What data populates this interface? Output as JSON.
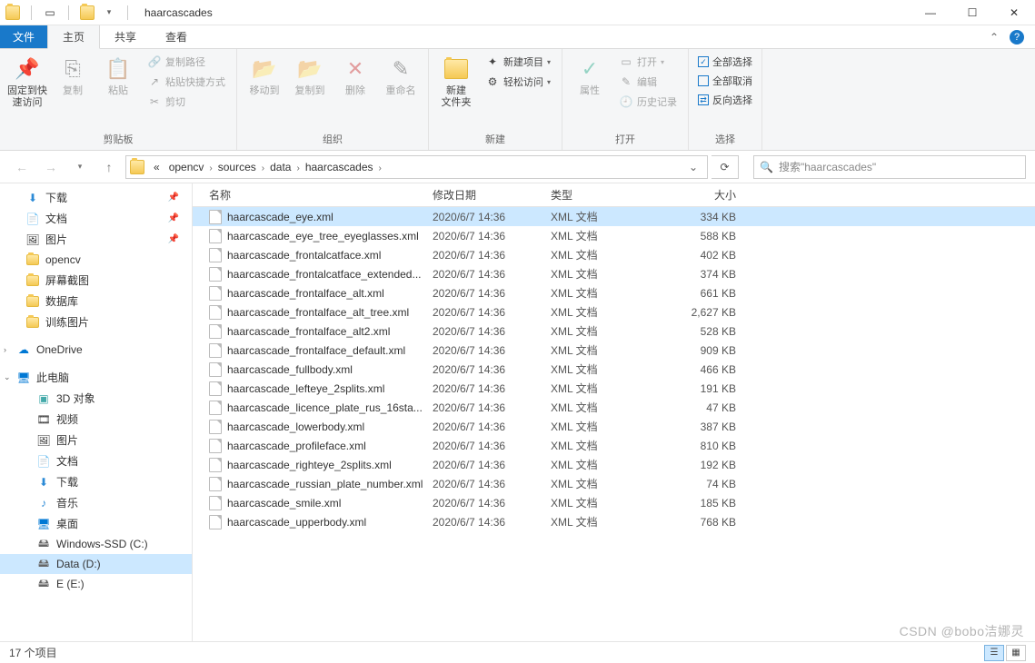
{
  "window": {
    "title": "haarcascades"
  },
  "tabs": {
    "file": "文件",
    "home": "主页",
    "share": "共享",
    "view": "查看"
  },
  "ribbon": {
    "pin": "固定到快\n速访问",
    "copy": "复制",
    "paste": "粘贴",
    "copy_path": "复制路径",
    "paste_shortcut": "粘贴快捷方式",
    "cut": "剪切",
    "clipboard_group": "剪贴板",
    "move_to": "移动到",
    "copy_to": "复制到",
    "delete": "删除",
    "rename": "重命名",
    "organize_group": "组织",
    "new_folder": "新建\n文件夹",
    "new_item": "新建项目",
    "easy_access": "轻松访问",
    "new_group": "新建",
    "properties": "属性",
    "open": "打开",
    "edit": "编辑",
    "history": "历史记录",
    "open_group": "打开",
    "select_all": "全部选择",
    "select_none": "全部取消",
    "invert": "反向选择",
    "select_group": "选择"
  },
  "breadcrumb": {
    "parts": [
      "opencv",
      "sources",
      "data",
      "haarcascades"
    ],
    "prefix": "«"
  },
  "search": {
    "placeholder": "搜索\"haarcascades\""
  },
  "nav": {
    "downloads": "下载",
    "documents": "文档",
    "pictures": "图片",
    "opencv": "opencv",
    "screenshots": "屏幕截图",
    "database": "数据库",
    "train_pics": "训练图片",
    "onedrive": "OneDrive",
    "this_pc": "此电脑",
    "objects3d": "3D 对象",
    "videos": "视频",
    "pictures2": "图片",
    "documents2": "文档",
    "downloads2": "下载",
    "music": "音乐",
    "desktop": "桌面",
    "disk_c": "Windows-SSD (C:)",
    "disk_d": "Data (D:)",
    "disk_e": "E (E:)"
  },
  "columns": {
    "name": "名称",
    "date": "修改日期",
    "type": "类型",
    "size": "大小"
  },
  "file_type": "XML 文档",
  "files": [
    {
      "name": "haarcascade_eye.xml",
      "date": "2020/6/7 14:36",
      "size": "334 KB",
      "selected": true
    },
    {
      "name": "haarcascade_eye_tree_eyeglasses.xml",
      "date": "2020/6/7 14:36",
      "size": "588 KB"
    },
    {
      "name": "haarcascade_frontalcatface.xml",
      "date": "2020/6/7 14:36",
      "size": "402 KB"
    },
    {
      "name": "haarcascade_frontalcatface_extended...",
      "date": "2020/6/7 14:36",
      "size": "374 KB"
    },
    {
      "name": "haarcascade_frontalface_alt.xml",
      "date": "2020/6/7 14:36",
      "size": "661 KB"
    },
    {
      "name": "haarcascade_frontalface_alt_tree.xml",
      "date": "2020/6/7 14:36",
      "size": "2,627 KB"
    },
    {
      "name": "haarcascade_frontalface_alt2.xml",
      "date": "2020/6/7 14:36",
      "size": "528 KB"
    },
    {
      "name": "haarcascade_frontalface_default.xml",
      "date": "2020/6/7 14:36",
      "size": "909 KB"
    },
    {
      "name": "haarcascade_fullbody.xml",
      "date": "2020/6/7 14:36",
      "size": "466 KB"
    },
    {
      "name": "haarcascade_lefteye_2splits.xml",
      "date": "2020/6/7 14:36",
      "size": "191 KB"
    },
    {
      "name": "haarcascade_licence_plate_rus_16sta...",
      "date": "2020/6/7 14:36",
      "size": "47 KB"
    },
    {
      "name": "haarcascade_lowerbody.xml",
      "date": "2020/6/7 14:36",
      "size": "387 KB"
    },
    {
      "name": "haarcascade_profileface.xml",
      "date": "2020/6/7 14:36",
      "size": "810 KB"
    },
    {
      "name": "haarcascade_righteye_2splits.xml",
      "date": "2020/6/7 14:36",
      "size": "192 KB"
    },
    {
      "name": "haarcascade_russian_plate_number.xml",
      "date": "2020/6/7 14:36",
      "size": "74 KB"
    },
    {
      "name": "haarcascade_smile.xml",
      "date": "2020/6/7 14:36",
      "size": "185 KB"
    },
    {
      "name": "haarcascade_upperbody.xml",
      "date": "2020/6/7 14:36",
      "size": "768 KB"
    }
  ],
  "status": {
    "count": "17 个项目"
  },
  "watermark": "CSDN @bobo洁娜灵"
}
